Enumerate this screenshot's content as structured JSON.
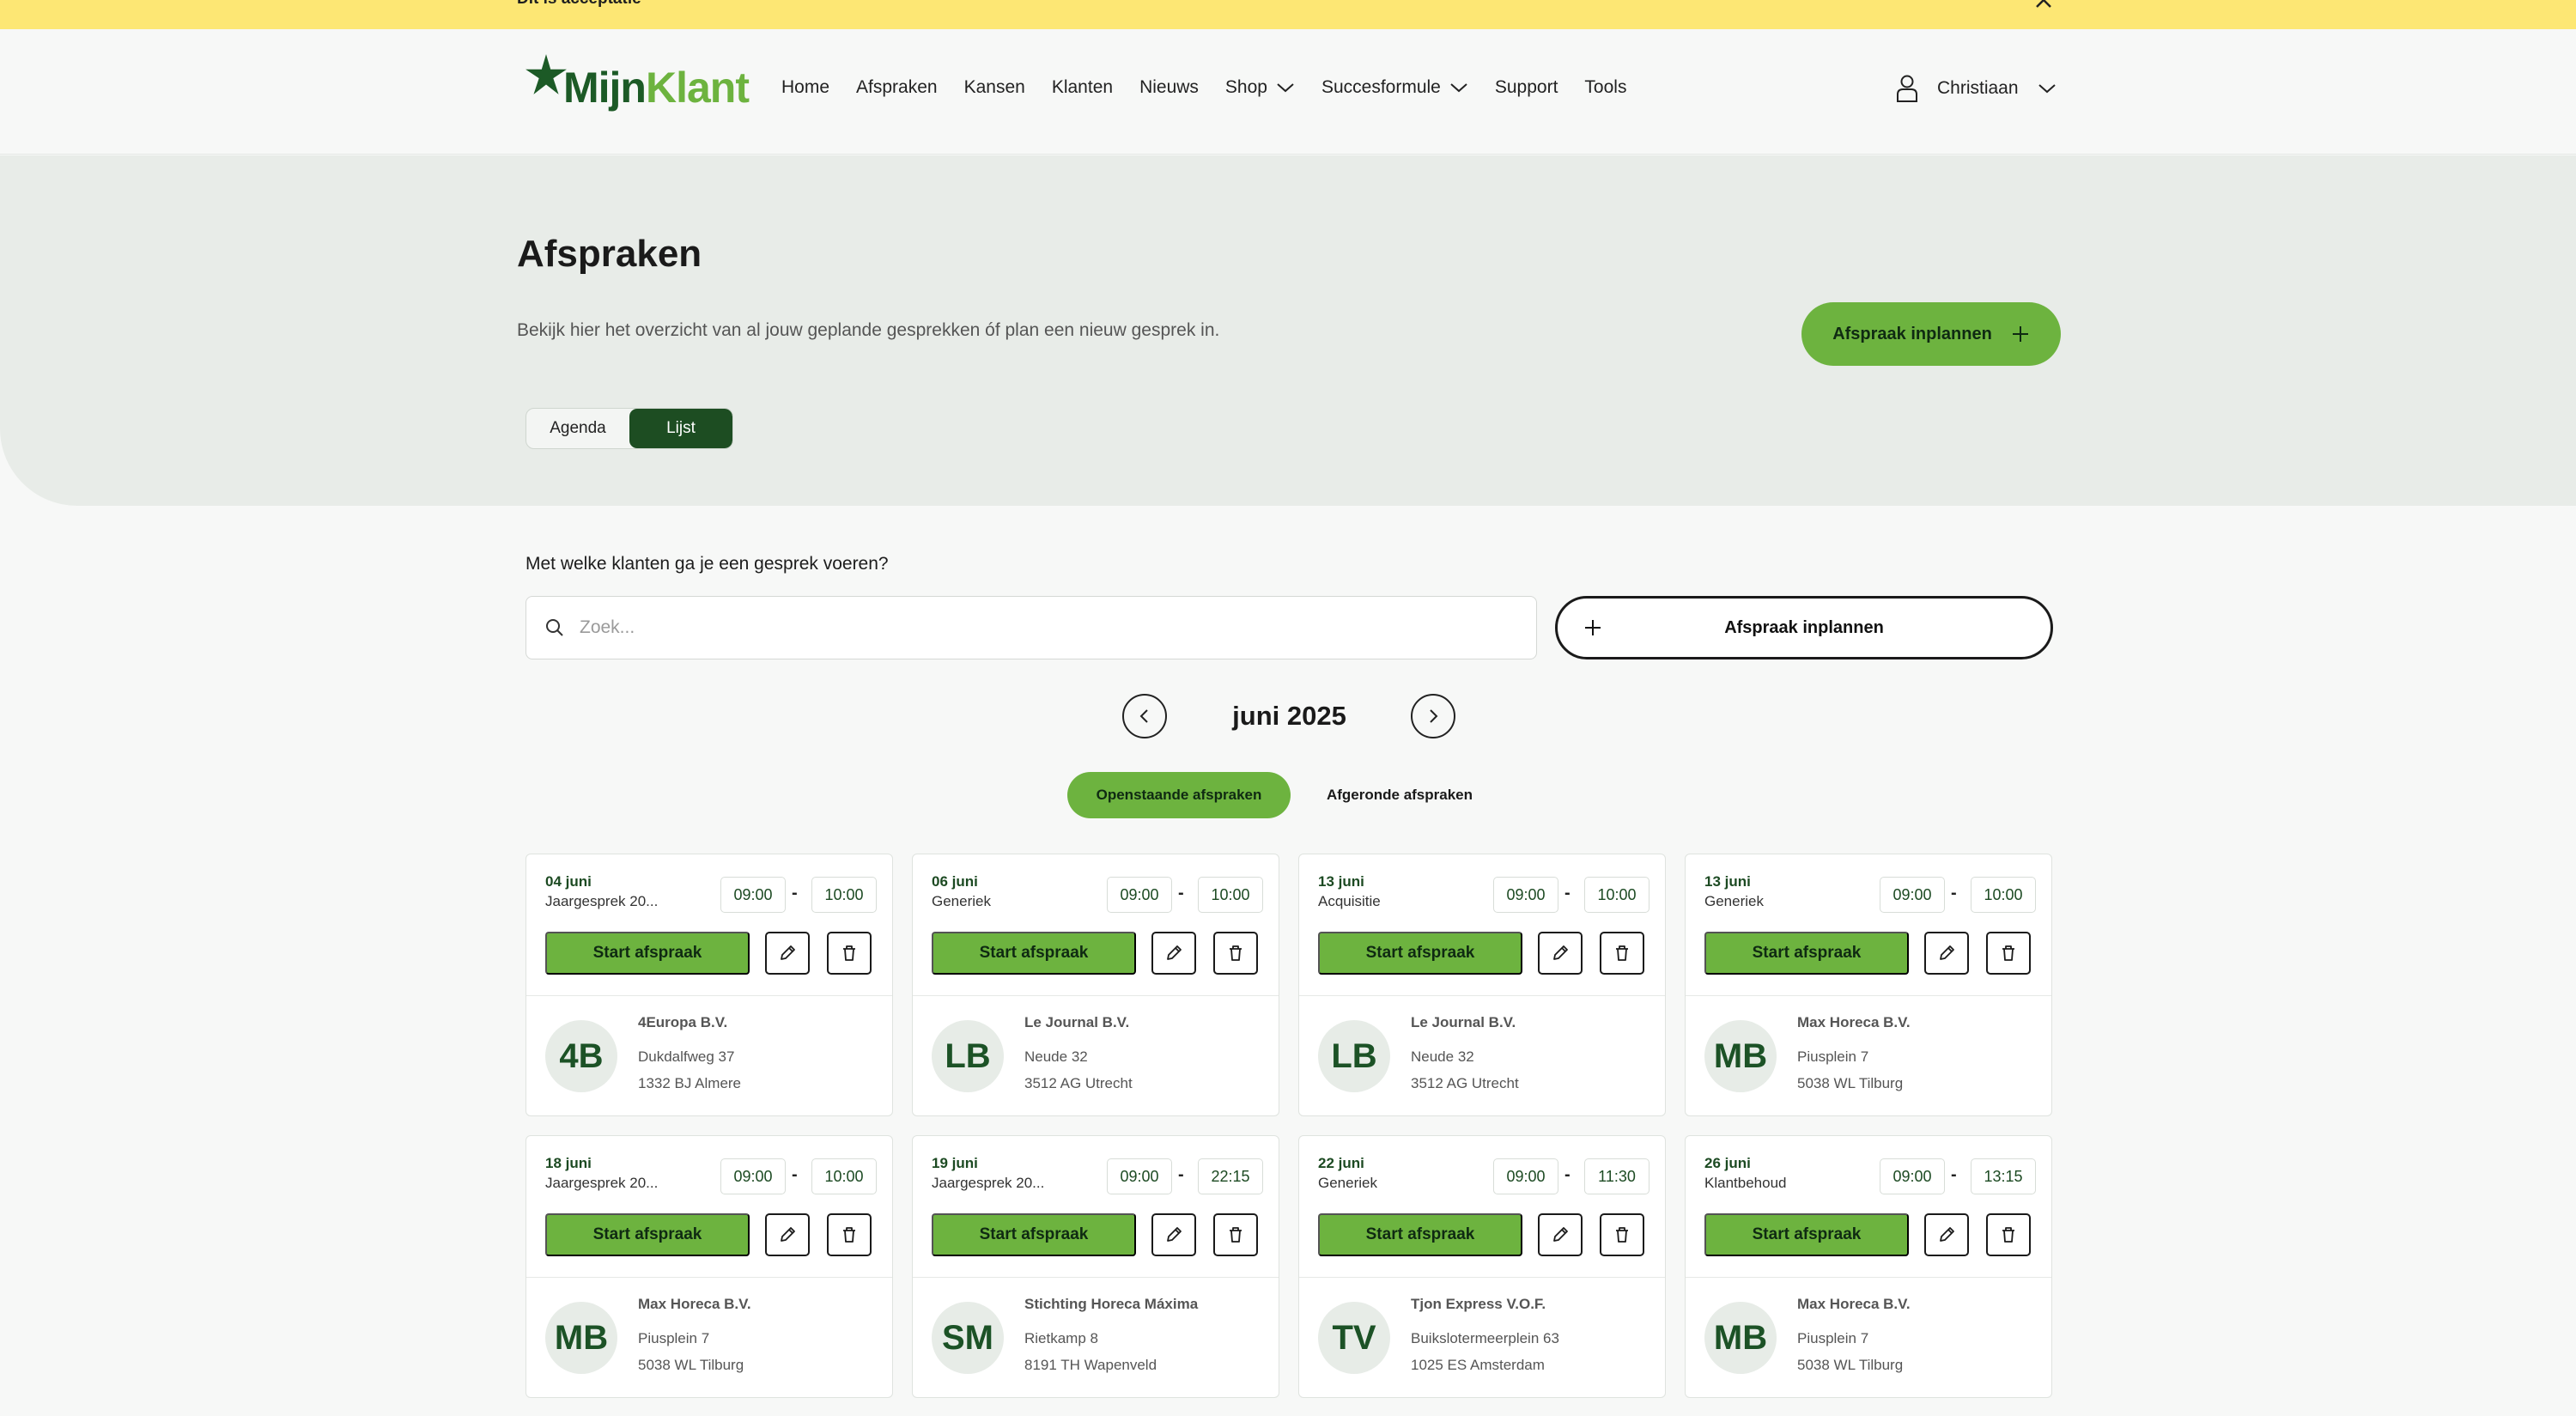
{
  "banner": {
    "text": "Dit is acceptatie"
  },
  "logo": {
    "mijn": "Mijn",
    "klant": "Klant"
  },
  "nav": {
    "items": [
      {
        "label": "Home"
      },
      {
        "label": "Afspraken"
      },
      {
        "label": "Kansen"
      },
      {
        "label": "Klanten"
      },
      {
        "label": "Nieuws"
      },
      {
        "label": "Shop"
      },
      {
        "label": "Succesformule"
      },
      {
        "label": "Support"
      },
      {
        "label": "Tools"
      }
    ]
  },
  "user": {
    "name": "Christiaan"
  },
  "hero": {
    "title": "Afspraken",
    "subtitle": "Bekijk hier het overzicht van al jouw geplande gesprekken óf plan een nieuw gesprek in.",
    "cta": "Afspraak inplannen",
    "view_agenda": "Agenda",
    "view_list": "Lijst"
  },
  "search": {
    "question": "Met welke klanten ga je een gesprek voeren?",
    "placeholder": "Zoek...",
    "value": "",
    "cta": "Afspraak inplannen"
  },
  "month": {
    "label": "juni 2025"
  },
  "filters": {
    "open": "Openstaande afspraken",
    "done": "Afgeronde afspraken"
  },
  "card_labels": {
    "start": "Start afspraak",
    "dash": "-"
  },
  "cards": [
    {
      "date": "04 juni",
      "type": "Jaargesprek 20...",
      "start": "09:00",
      "end": "10:00",
      "initials": "4B",
      "company": "4Europa B.V.",
      "street": "Dukdalfweg 37",
      "city": "1332 BJ Almere"
    },
    {
      "date": "06 juni",
      "type": "Generiek",
      "start": "09:00",
      "end": "10:00",
      "initials": "LB",
      "company": "Le Journal B.V.",
      "street": "Neude 32",
      "city": "3512 AG Utrecht"
    },
    {
      "date": "13 juni",
      "type": "Acquisitie",
      "start": "09:00",
      "end": "10:00",
      "initials": "LB",
      "company": "Le Journal B.V.",
      "street": "Neude 32",
      "city": "3512 AG Utrecht"
    },
    {
      "date": "13 juni",
      "type": "Generiek",
      "start": "09:00",
      "end": "10:00",
      "initials": "MB",
      "company": "Max Horeca B.V.",
      "street": "Piusplein 7",
      "city": "5038 WL Tilburg"
    },
    {
      "date": "18 juni",
      "type": "Jaargesprek 20...",
      "start": "09:00",
      "end": "10:00",
      "initials": "MB",
      "company": "Max Horeca B.V.",
      "street": "Piusplein 7",
      "city": "5038 WL Tilburg"
    },
    {
      "date": "19 juni",
      "type": "Jaargesprek 20...",
      "start": "09:00",
      "end": "22:15",
      "initials": "SM",
      "company": "Stichting Horeca Máxima",
      "street": "Rietkamp 8",
      "city": "8191 TH Wapenveld"
    },
    {
      "date": "22 juni",
      "type": "Generiek",
      "start": "09:00",
      "end": "11:30",
      "initials": "TV",
      "company": "Tjon Express V.O.F.",
      "street": "Buikslotermeerplein 63",
      "city": "1025 ES Amsterdam"
    },
    {
      "date": "26 juni",
      "type": "Klantbehoud",
      "start": "09:00",
      "end": "13:15",
      "initials": "MB",
      "company": "Max Horeca B.V.",
      "street": "Piusplein 7",
      "city": "5038 WL Tilburg"
    }
  ],
  "colors": {
    "accent": "#6db33f",
    "dark_green": "#1d4d22",
    "banner": "#fde774"
  }
}
